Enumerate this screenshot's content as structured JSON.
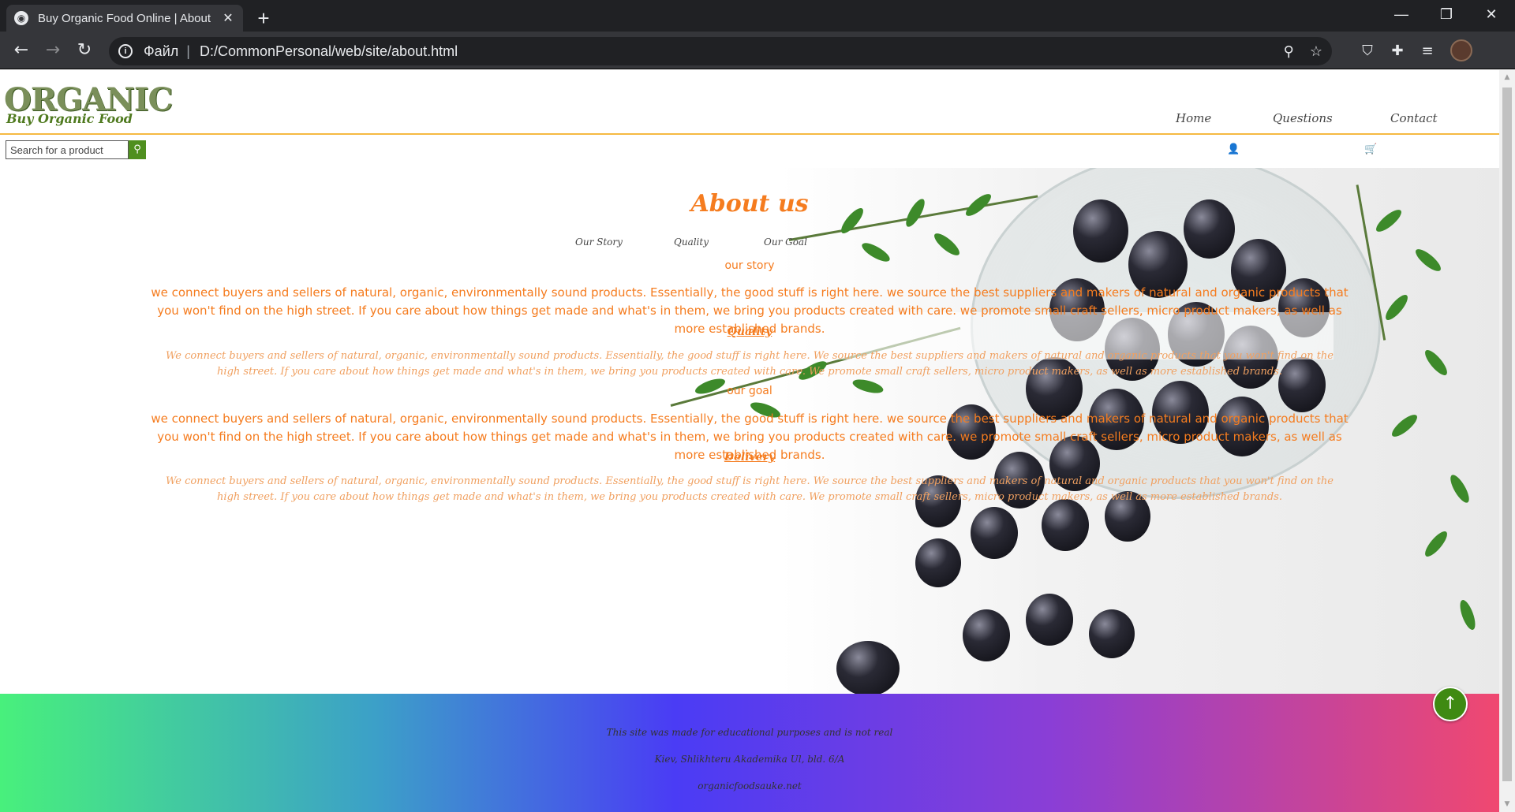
{
  "browser": {
    "tab_title": "Buy Organic Food Online | About",
    "tab_close": "✕",
    "new_tab": "+",
    "window_controls": [
      "—",
      "❐",
      "✕"
    ],
    "nav": {
      "back": "←",
      "forward": "→",
      "reload": "↻"
    },
    "address": {
      "scheme_label": "Файл",
      "separator": "|",
      "url": "D:/CommonPersonal/web/site/about.html"
    },
    "address_icons": {
      "zoom": "⚲",
      "bookmark": "☆"
    },
    "extensions": [
      "⛉",
      "✚",
      "≡"
    ]
  },
  "site": {
    "logo": {
      "main": "ORGANIC",
      "sub": "Buy Organic Food"
    },
    "nav": [
      "Home",
      "Questions",
      "Contact"
    ],
    "search": {
      "placeholder": "Search for a product",
      "button_icon": "⚲"
    },
    "user_icon": "👤",
    "cart_icon": "🛒",
    "colors": {
      "accent": "#f57c1f",
      "header_line": "#f5b942",
      "search_button": "#4f8f1f",
      "to_top": "#3f8a12"
    }
  },
  "about": {
    "title": "About us",
    "sub_nav": [
      "Our Story",
      "Quality",
      "Our Goal"
    ],
    "sections": [
      {
        "heading": "our story",
        "text": "we connect buyers and sellers of natural, organic, environmentally sound products. Essentially, the good stuff is right here. we source the best suppliers and makers of natural and organic products that you won't find on the high street. If you care about how things get made and what's in them, we bring you products created with care. we promote small craft sellers, micro product makers, as well as more established brands."
      },
      {
        "heading": "Quality",
        "text": "We connect buyers and sellers of natural, organic, environmentally sound products. Essentially, the good stuff is right here. We source the best suppliers and makers of natural and organic products that you won't find on the high street. If you care about how things get made and what's in them, we bring you products created with care. We promote small craft sellers, micro product makers, as well as more established brands."
      },
      {
        "heading": "our goal",
        "text": "we connect buyers and sellers of natural, organic, environmentally sound products. Essentially, the good stuff is right here. we source the best suppliers and makers of natural and organic products that you won't find on the high street. If you care about how things get made and what's in them, we bring you products created with care. we promote small craft sellers, micro product makers, as well as more established brands."
      },
      {
        "heading": "Delivery",
        "text": "We connect buyers and sellers of natural, organic, environmentally sound products. Essentially, the good stuff is right here. We source the best suppliers and makers of natural and organic products that you won't find on the high street. If you care about how things get made and what's in them, we bring you products created with care. We promote small craft sellers, micro product makers, as well as more established brands."
      }
    ]
  },
  "footer": {
    "disclaimer": "This site was made for educational purposes and is not real",
    "address": "Kiev, Shlikhteru Akademika Ul, bld. 6/A",
    "email": "organicfoodsauke.net"
  },
  "to_top": "↑"
}
